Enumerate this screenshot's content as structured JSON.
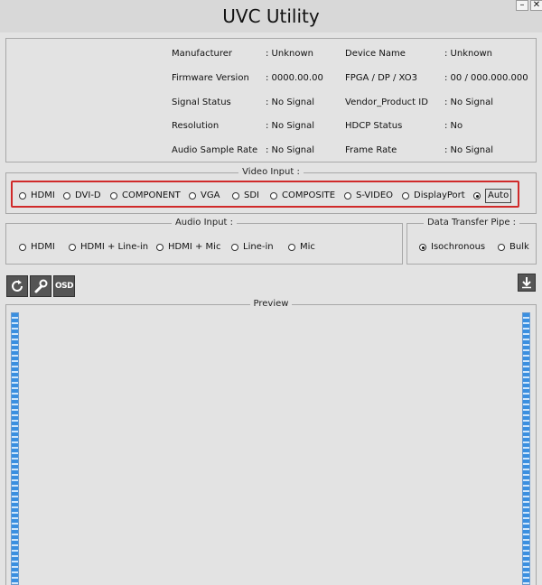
{
  "window": {
    "title": "UVC Utility",
    "minimize_label": "–",
    "close_label": "✕"
  },
  "info": {
    "manufacturer": {
      "label": "Manufacturer",
      "value": ": Unknown"
    },
    "firmware": {
      "label": "Firmware Version",
      "value": ": 0000.00.00"
    },
    "signal_status": {
      "label": "Signal Status",
      "value": ": No Signal"
    },
    "resolution": {
      "label": "Resolution",
      "value": ": No Signal"
    },
    "audio_sample_rate": {
      "label": "Audio Sample Rate",
      "value": ": No Signal"
    },
    "device_name": {
      "label": "Device Name",
      "value": ": Unknown"
    },
    "fpga": {
      "label": "FPGA / DP / XO3",
      "value": ": 00 / 000.000.000"
    },
    "vendor_product": {
      "label": "Vendor_Product ID",
      "value": ": No Signal"
    },
    "hdcp": {
      "label": "HDCP Status",
      "value": ": No"
    },
    "frame_rate": {
      "label": "Frame Rate",
      "value": ": No Signal"
    }
  },
  "video_input": {
    "legend": "Video Input :",
    "selected": "Auto",
    "options": [
      "HDMI",
      "DVI-D",
      "COMPONENT",
      "VGA",
      "SDI",
      "COMPOSITE",
      "S-VIDEO",
      "DisplayPort",
      "Auto"
    ]
  },
  "audio_input": {
    "legend": "Audio Input :",
    "selected": "",
    "options": [
      "HDMI",
      "HDMI + Line-in",
      "HDMI + Mic",
      "Line-in",
      "Mic"
    ]
  },
  "data_transfer_pipe": {
    "legend": "Data Transfer Pipe :",
    "selected": "Isochronous",
    "options": [
      "Isochronous",
      "Bulk"
    ]
  },
  "toolbar": {
    "osd_label": "OSD",
    "refresh_icon": "refresh-icon",
    "settings_icon": "wrench-icon",
    "download_icon": "download-icon"
  },
  "preview": {
    "legend": "Preview"
  },
  "colors": {
    "highlight": "#d02a2a",
    "meter_fill": "#3a8fe0"
  }
}
